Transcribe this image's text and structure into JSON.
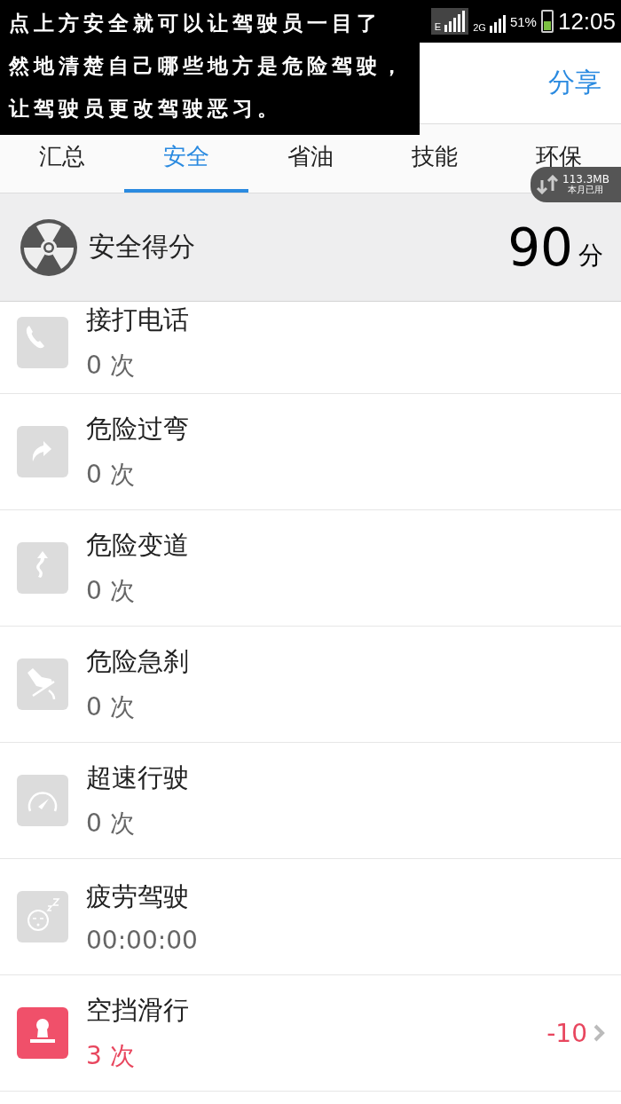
{
  "status_bar": {
    "network_label": "E",
    "second_network_label": "2G",
    "battery": "51%",
    "time": "12:05"
  },
  "tip_overlay": {
    "lines": [
      "点上方安全就可以让驾驶员一目了",
      "然地清楚自己哪些地方是危险驾驶，",
      "让驾驶员更改驾驶恶习。"
    ]
  },
  "header": {
    "share": "分享"
  },
  "tabs": [
    {
      "label": "汇总",
      "selected": false
    },
    {
      "label": "安全",
      "selected": true
    },
    {
      "label": "省油",
      "selected": false
    },
    {
      "label": "技能",
      "selected": false
    },
    {
      "label": "环保",
      "selected": false
    }
  ],
  "data_badge": {
    "amount": "113.3MB",
    "caption": "本月已用"
  },
  "score": {
    "label": "安全得分",
    "value": "90",
    "unit": "分"
  },
  "items": [
    {
      "kind": "phone",
      "title": "接打电话",
      "count": "0 次",
      "alert": false
    },
    {
      "kind": "turn",
      "title": "危险过弯",
      "count": "0 次",
      "alert": false
    },
    {
      "kind": "lane",
      "title": "危险变道",
      "count": "0 次",
      "alert": false
    },
    {
      "kind": "brake",
      "title": "危险急刹",
      "count": "0 次",
      "alert": false
    },
    {
      "kind": "speed",
      "title": "超速行驶",
      "count": "0 次",
      "alert": false
    },
    {
      "kind": "fatigue",
      "title": "疲劳驾驶",
      "count": "00:00:00",
      "alert": false
    },
    {
      "kind": "coast",
      "title": "空挡滑行",
      "count": "3 次",
      "alert": true,
      "penalty": "-10"
    }
  ]
}
